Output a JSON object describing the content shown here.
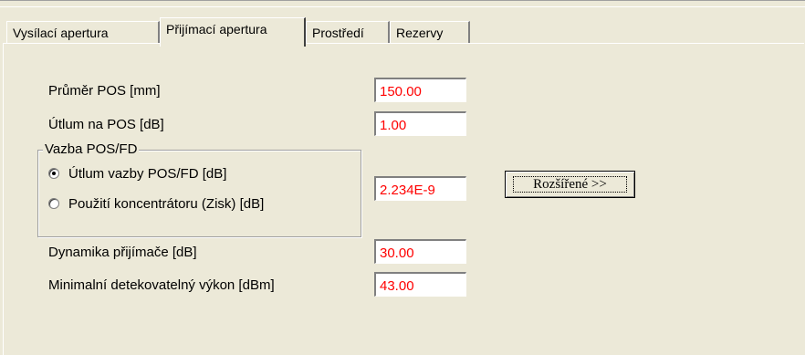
{
  "tabs": [
    {
      "label": "Vysílací apertura",
      "active": false
    },
    {
      "label": "Přijímací apertura",
      "active": true
    },
    {
      "label": "Prostředí",
      "active": false
    },
    {
      "label": "Rezervy",
      "active": false
    }
  ],
  "fields": {
    "prumer_pos": {
      "label": "Průměr POS [mm]",
      "value": "150.00"
    },
    "utlum_pos": {
      "label": "Útlum na POS [dB]",
      "value": "1.00"
    },
    "vazba_value": {
      "value": "2.234E-9"
    },
    "dynamika": {
      "label": "Dynamika přijímače [dB]",
      "value": "30.00"
    },
    "min_vykon": {
      "label": "Minimalní detekovatelný výkon [dBm]",
      "value": "43.00"
    }
  },
  "group": {
    "title": "Vazba POS/FD",
    "options": [
      {
        "label": "Útlum vazby POS/FD  [dB]",
        "checked": true
      },
      {
        "label": "Použití koncentrátoru (Zisk)  [dB]",
        "checked": false
      }
    ]
  },
  "buttons": {
    "rozsirene": "Rozšířené >>"
  },
  "colors": {
    "window_bg": "#ece9d8",
    "value_text": "#ff0000"
  }
}
